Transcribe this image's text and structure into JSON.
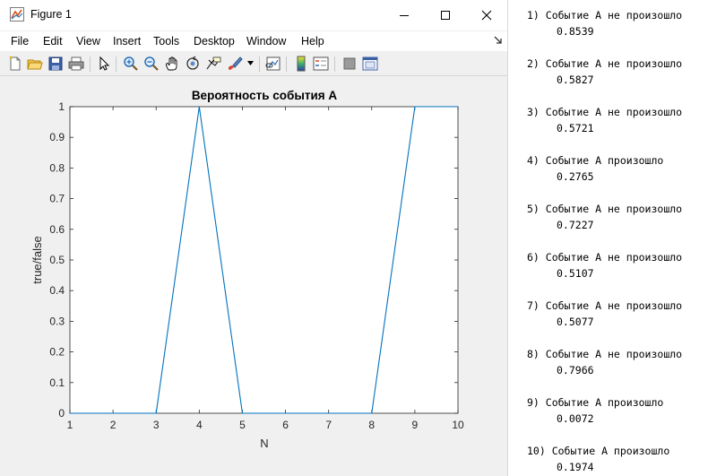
{
  "window": {
    "title": "Figure 1"
  },
  "menu": [
    "File",
    "Edit",
    "View",
    "Insert",
    "Tools",
    "Desktop",
    "Window",
    "Help"
  ],
  "toolbar_icons": [
    "new-figure-icon",
    "open-file-icon",
    "save-icon",
    "print-icon",
    "select-arrow-icon",
    "zoom-in-icon",
    "zoom-out-icon",
    "pan-hand-icon",
    "rotate-3d-icon",
    "data-cursor-icon",
    "brush-icon",
    "link-plot-icon",
    "colorbar-icon",
    "legend-icon",
    "hide-plot-tools-icon",
    "show-plot-tools-icon"
  ],
  "chart_data": {
    "type": "line",
    "title": "Вероятность события А",
    "xlabel": "N",
    "ylabel": "true/false",
    "x": [
      1,
      2,
      3,
      4,
      5,
      6,
      7,
      8,
      9,
      10
    ],
    "y": [
      0,
      0,
      0,
      1,
      0,
      0,
      0,
      0,
      1,
      1
    ],
    "xlim": [
      1,
      10
    ],
    "ylim": [
      0,
      1
    ],
    "xticks": [
      "1",
      "2",
      "3",
      "4",
      "5",
      "6",
      "7",
      "8",
      "9",
      "10"
    ],
    "yticks": [
      "0",
      "0.1",
      "0.2",
      "0.3",
      "0.4",
      "0.5",
      "0.6",
      "0.7",
      "0.8",
      "0.9",
      "1"
    ],
    "line_color": "#0072bd",
    "grid": false
  },
  "console": [
    {
      "line1": "1) Событие А не произошло",
      "line2": "0.8539"
    },
    {
      "line1": "2) Событие А не произошло",
      "line2": "0.5827"
    },
    {
      "line1": "3) Событие А не произошло",
      "line2": "0.5721"
    },
    {
      "line1": "4) Событие А произошло",
      "line2": "0.2765"
    },
    {
      "line1": "5) Событие А не произошло",
      "line2": "0.7227"
    },
    {
      "line1": "6) Событие А не произошло",
      "line2": "0.5107"
    },
    {
      "line1": "7) Событие А не произошло",
      "line2": "0.5077"
    },
    {
      "line1": "8) Событие А не произошло",
      "line2": "0.7966"
    },
    {
      "line1": "9) Событие А произошло",
      "line2": "0.0072"
    },
    {
      "line1": "10) Событие А произошло",
      "line2": "0.1974"
    }
  ]
}
